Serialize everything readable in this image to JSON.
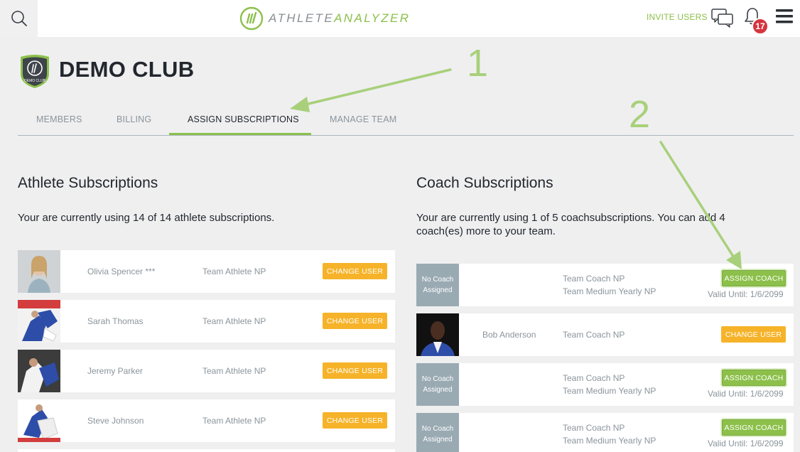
{
  "topbar": {
    "logo_part1": "ATHLETE",
    "logo_part2": "ANALYZER",
    "invite_label": "INVITE USERS",
    "notification_count": "17"
  },
  "club": {
    "name": "DEMO CLUB",
    "shield_text": "DEMO CLUB"
  },
  "tabs": [
    {
      "label": "MEMBERS"
    },
    {
      "label": "BILLING"
    },
    {
      "label": "ASSIGN SUBSCRIPTIONS",
      "active": true
    },
    {
      "label": "MANAGE TEAM"
    }
  ],
  "athlete": {
    "title": "Athlete Subscriptions",
    "usage": "Your are currently using 14 of 14 athlete subscriptions.",
    "rows": [
      {
        "name": "Olivia Spencer ***",
        "plan": "Team Athlete NP",
        "button": "CHANGE USER"
      },
      {
        "name": "Sarah Thomas",
        "plan": "Team Athlete NP",
        "button": "CHANGE USER"
      },
      {
        "name": "Jeremy Parker",
        "plan": "Team Athlete NP",
        "button": "CHANGE USER"
      },
      {
        "name": "Steve Johnson",
        "plan": "Team Athlete NP",
        "button": "CHANGE USER"
      }
    ]
  },
  "coach": {
    "title": "Coach Subscriptions",
    "usage": "Your are currently using 1 of 5 coachsubscriptions. You can add 4 coach(es) more to your team.",
    "no_coach_label": "No Coach Assigned",
    "rows": [
      {
        "name": "",
        "plan": "Team Coach NP",
        "plan2": "Team Medium Yearly NP",
        "button": "ASSIGN COACH",
        "valid": "Valid Until: 1/6/2099"
      },
      {
        "name": "Bob Anderson",
        "plan": "Team Coach NP",
        "button": "CHANGE USER"
      },
      {
        "name": "",
        "plan": "Team Coach NP",
        "plan2": "Team Medium Yearly NP",
        "button": "ASSIGN COACH",
        "valid": "Valid Until: 1/6/2099"
      },
      {
        "name": "",
        "plan": "Team Coach NP",
        "plan2": "Team Medium Yearly NP",
        "button": "ASSIGN COACH",
        "valid": "Valid Until: 1/6/2099"
      }
    ]
  },
  "annotations": {
    "step1": "1",
    "step2": "2"
  },
  "colors": {
    "accent_green": "#8cc04b",
    "change_orange": "#f6b329",
    "badge_red": "#d5353f",
    "annotation_green": "#a8d07a"
  }
}
